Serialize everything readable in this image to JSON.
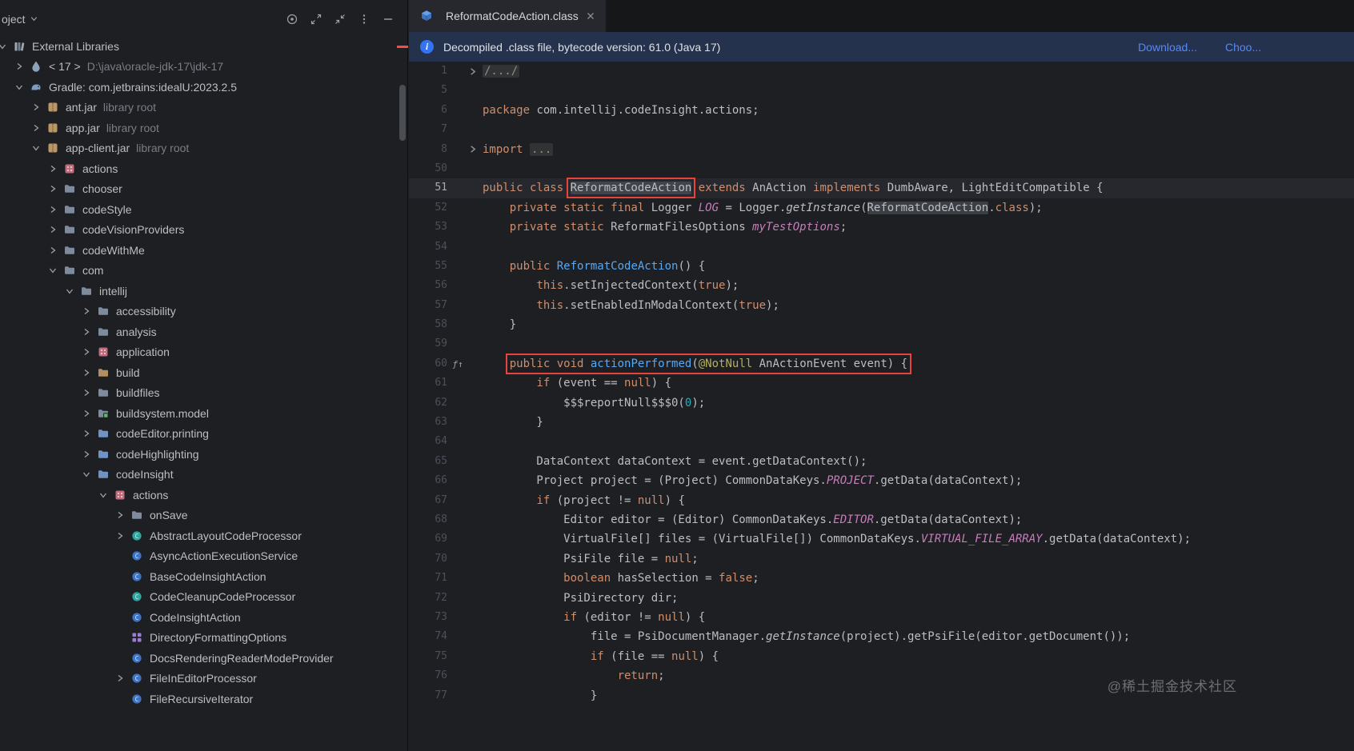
{
  "sidebar": {
    "header": {
      "title": "oject",
      "icons": [
        "target",
        "maximize",
        "collapse",
        "more",
        "hide"
      ]
    },
    "tree": [
      {
        "level": 0,
        "chev": "down",
        "icon": "library",
        "label": "External Libraries"
      },
      {
        "level": 1,
        "chev": "right",
        "icon": "jdk",
        "label": "< 17 >",
        "suffix": "D:\\java\\oracle-jdk-17\\jdk-17"
      },
      {
        "level": 1,
        "chev": "down",
        "icon": "gradle",
        "label": "Gradle: com.jetbrains:idealU:2023.2.5"
      },
      {
        "level": 2,
        "chev": "right",
        "icon": "jar",
        "label": "ant.jar",
        "suffix": "library root"
      },
      {
        "level": 2,
        "chev": "right",
        "icon": "jar",
        "label": "app.jar",
        "suffix": "library root"
      },
      {
        "level": 2,
        "chev": "down",
        "icon": "jar",
        "label": "app-client.jar",
        "suffix": "library root"
      },
      {
        "level": 3,
        "chev": "right",
        "icon": "package",
        "label": "actions"
      },
      {
        "level": 3,
        "chev": "right",
        "icon": "folder",
        "label": "chooser"
      },
      {
        "level": 3,
        "chev": "right",
        "icon": "folder",
        "label": "codeStyle"
      },
      {
        "level": 3,
        "chev": "right",
        "icon": "folder",
        "label": "codeVisionProviders"
      },
      {
        "level": 3,
        "chev": "right",
        "icon": "folder",
        "label": "codeWithMe"
      },
      {
        "level": 3,
        "chev": "down",
        "icon": "folder",
        "label": "com"
      },
      {
        "level": 4,
        "chev": "down",
        "icon": "folder",
        "label": "intellij"
      },
      {
        "level": 5,
        "chev": "right",
        "icon": "folder",
        "label": "accessibility"
      },
      {
        "level": 5,
        "chev": "right",
        "icon": "folder",
        "label": "analysis"
      },
      {
        "level": 5,
        "chev": "right",
        "icon": "package",
        "label": "application"
      },
      {
        "level": 5,
        "chev": "right",
        "icon": "folderBuild",
        "label": "build"
      },
      {
        "level": 5,
        "chev": "right",
        "icon": "folder",
        "label": "buildfiles"
      },
      {
        "level": 5,
        "chev": "right",
        "icon": "folderModel",
        "label": "buildsystem.model"
      },
      {
        "level": 5,
        "chev": "right",
        "icon": "folderBlue",
        "label": "codeEditor.printing"
      },
      {
        "level": 5,
        "chev": "right",
        "icon": "folderBlue",
        "label": "codeHighlighting"
      },
      {
        "level": 5,
        "chev": "down",
        "icon": "folderBlue",
        "label": "codeInsight"
      },
      {
        "level": 6,
        "chev": "down",
        "icon": "package",
        "label": "actions"
      },
      {
        "level": 7,
        "chev": "right",
        "icon": "folder",
        "label": "onSave"
      },
      {
        "level": 7,
        "chev": "right",
        "icon": "classTeal",
        "label": "AbstractLayoutCodeProcessor"
      },
      {
        "level": 7,
        "chev": "none",
        "icon": "classBlue",
        "label": "AsyncActionExecutionService"
      },
      {
        "level": 7,
        "chev": "none",
        "icon": "classBlue",
        "label": "BaseCodeInsightAction"
      },
      {
        "level": 7,
        "chev": "none",
        "icon": "classTeal",
        "label": "CodeCleanupCodeProcessor"
      },
      {
        "level": 7,
        "chev": "none",
        "icon": "classBlue",
        "label": "CodeInsightAction"
      },
      {
        "level": 7,
        "chev": "none",
        "icon": "gridPurple",
        "label": "DirectoryFormattingOptions"
      },
      {
        "level": 7,
        "chev": "none",
        "icon": "classBlue",
        "label": "DocsRenderingReaderModeProvider"
      },
      {
        "level": 7,
        "chev": "right",
        "icon": "classBlue",
        "label": "FileInEditorProcessor"
      },
      {
        "level": 7,
        "chev": "none",
        "icon": "classBlue",
        "label": "FileRecursiveIterator"
      }
    ]
  },
  "editor": {
    "tab": {
      "label": "ReformatCodeAction.class",
      "icon": "classfile"
    },
    "banner": {
      "icon": "info",
      "text": "Decompiled .class file, bytecode version: 61.0 (Java 17)",
      "download_label": "Download...",
      "choose_label": "Choo..."
    },
    "gutter": {
      "override_icon": "ƒ↑",
      "fold_icon": "chevron-right"
    },
    "lines": [
      {
        "n": 1,
        "f": 1,
        "t": [
          [
            "/.../",
            "fold"
          ]
        ]
      },
      {
        "n": 5,
        "t": []
      },
      {
        "n": 6,
        "t": [
          [
            "package ",
            "k"
          ],
          [
            "com.intellij.codeInsight.actions;",
            "d"
          ]
        ]
      },
      {
        "n": 7,
        "t": []
      },
      {
        "n": 8,
        "f": 1,
        "t": [
          [
            "import ",
            "k"
          ],
          [
            "...",
            "fold"
          ]
        ]
      },
      {
        "n": 50,
        "t": []
      },
      {
        "n": 51,
        "caret": 1,
        "t": [
          [
            "public class ",
            "k"
          ],
          [
            "ReformatCodeAction",
            "d hl box"
          ],
          [
            " ",
            "d"
          ],
          [
            "extends",
            "k"
          ],
          [
            " AnAction ",
            "d"
          ],
          [
            "implements",
            "k"
          ],
          [
            " DumbAware, LightEditCompatible {",
            "d"
          ]
        ]
      },
      {
        "n": 52,
        "t": [
          [
            "    ",
            "d"
          ],
          [
            "private static final ",
            "k"
          ],
          [
            "Logger ",
            "d"
          ],
          [
            "LOG",
            "f"
          ],
          [
            " = Logger.",
            "d"
          ],
          [
            "getInstance",
            "si"
          ],
          [
            "(",
            "d"
          ],
          [
            "ReformatCodeAction",
            "d hl"
          ],
          [
            ".",
            "d"
          ],
          [
            "class",
            "k"
          ],
          [
            ");",
            "d"
          ]
        ]
      },
      {
        "n": 53,
        "t": [
          [
            "    ",
            "d"
          ],
          [
            "private static ",
            "k"
          ],
          [
            "ReformatFilesOptions ",
            "d"
          ],
          [
            "myTestOptions",
            "f"
          ],
          [
            ";",
            "d"
          ]
        ]
      },
      {
        "n": 54,
        "t": []
      },
      {
        "n": 55,
        "t": [
          [
            "    ",
            "d"
          ],
          [
            "public ",
            "k"
          ],
          [
            "ReformatCodeAction",
            "m"
          ],
          [
            "() {",
            "d"
          ]
        ]
      },
      {
        "n": 56,
        "t": [
          [
            "        ",
            "d"
          ],
          [
            "this",
            "k"
          ],
          [
            ".setInjectedContext(",
            "d"
          ],
          [
            "true",
            "k"
          ],
          [
            ");",
            "d"
          ]
        ]
      },
      {
        "n": 57,
        "t": [
          [
            "        ",
            "d"
          ],
          [
            "this",
            "k"
          ],
          [
            ".setEnabledInModalContext(",
            "d"
          ],
          [
            "true",
            "k"
          ],
          [
            ");",
            "d"
          ]
        ]
      },
      {
        "n": 58,
        "t": [
          [
            "    }",
            "d"
          ]
        ]
      },
      {
        "n": 59,
        "t": []
      },
      {
        "n": 60,
        "g": 1,
        "t": [
          [
            "    ",
            "d"
          ],
          [
            "public void ",
            "k box"
          ],
          [
            "actionPerformed",
            "m box"
          ],
          [
            "(",
            "d box"
          ],
          [
            "@NotNull",
            "a box"
          ],
          [
            " AnActionEvent event) {",
            "d box"
          ]
        ]
      },
      {
        "n": 61,
        "t": [
          [
            "        ",
            "d"
          ],
          [
            "if",
            "k"
          ],
          [
            " (event == ",
            "d"
          ],
          [
            "null",
            "k"
          ],
          [
            ") {",
            "d"
          ]
        ]
      },
      {
        "n": 62,
        "t": [
          [
            "            $$$reportNull$$$0(",
            "d"
          ],
          [
            "0",
            "n"
          ],
          [
            ");",
            "d"
          ]
        ]
      },
      {
        "n": 63,
        "t": [
          [
            "        }",
            "d"
          ]
        ]
      },
      {
        "n": 64,
        "t": []
      },
      {
        "n": 65,
        "t": [
          [
            "        DataContext dataContext = event.getDataContext();",
            "d"
          ]
        ]
      },
      {
        "n": 66,
        "t": [
          [
            "        Project project = (Project) CommonDataKeys.",
            "d"
          ],
          [
            "PROJECT",
            "f"
          ],
          [
            ".getData(dataContext);",
            "d"
          ]
        ]
      },
      {
        "n": 67,
        "t": [
          [
            "        ",
            "d"
          ],
          [
            "if",
            "k"
          ],
          [
            " (project != ",
            "d"
          ],
          [
            "null",
            "k"
          ],
          [
            ") {",
            "d"
          ]
        ]
      },
      {
        "n": 68,
        "t": [
          [
            "            Editor editor = (Editor) CommonDataKeys.",
            "d"
          ],
          [
            "EDITOR",
            "f"
          ],
          [
            ".getData(dataContext);",
            "d"
          ]
        ]
      },
      {
        "n": 69,
        "t": [
          [
            "            VirtualFile[] files = (VirtualFile[]) CommonDataKeys.",
            "d"
          ],
          [
            "VIRTUAL_FILE_ARRAY",
            "f"
          ],
          [
            ".getData(dataContext);",
            "d"
          ]
        ]
      },
      {
        "n": 70,
        "t": [
          [
            "            PsiFile file = ",
            "d"
          ],
          [
            "null",
            "k"
          ],
          [
            ";",
            "d"
          ]
        ]
      },
      {
        "n": 71,
        "t": [
          [
            "            ",
            "d"
          ],
          [
            "boolean",
            "k"
          ],
          [
            " hasSelection = ",
            "d"
          ],
          [
            "false",
            "k"
          ],
          [
            ";",
            "d"
          ]
        ]
      },
      {
        "n": 72,
        "t": [
          [
            "            PsiDirectory dir;",
            "d"
          ]
        ]
      },
      {
        "n": 73,
        "t": [
          [
            "            ",
            "d"
          ],
          [
            "if",
            "k"
          ],
          [
            " (editor != ",
            "d"
          ],
          [
            "null",
            "k"
          ],
          [
            ") {",
            "d"
          ]
        ]
      },
      {
        "n": 74,
        "t": [
          [
            "                file = PsiDocumentManager.",
            "d"
          ],
          [
            "getInstance",
            "si"
          ],
          [
            "(project).getPsiFile(editor.getDocument());",
            "d"
          ]
        ]
      },
      {
        "n": 75,
        "t": [
          [
            "                ",
            "d"
          ],
          [
            "if",
            "k"
          ],
          [
            " (file == ",
            "d"
          ],
          [
            "null",
            "k"
          ],
          [
            ") {",
            "d"
          ]
        ]
      },
      {
        "n": 76,
        "t": [
          [
            "                    ",
            "d"
          ],
          [
            "return",
            "k"
          ],
          [
            ";",
            "d"
          ]
        ]
      },
      {
        "n": 77,
        "t": [
          [
            "                }",
            "d"
          ]
        ]
      }
    ]
  },
  "watermark": "@稀土掘金技术社区",
  "colors": {
    "background": "#1e1f22",
    "banner_bg": "#25324d",
    "accent_blue": "#3574f0",
    "link": "#548af7",
    "keyword": "#cf8e6d",
    "field": "#c77dbb",
    "method": "#56a8f5",
    "annotation": "#b3ae60",
    "number": "#2aacb8",
    "highlight_box": "#e8433c"
  }
}
